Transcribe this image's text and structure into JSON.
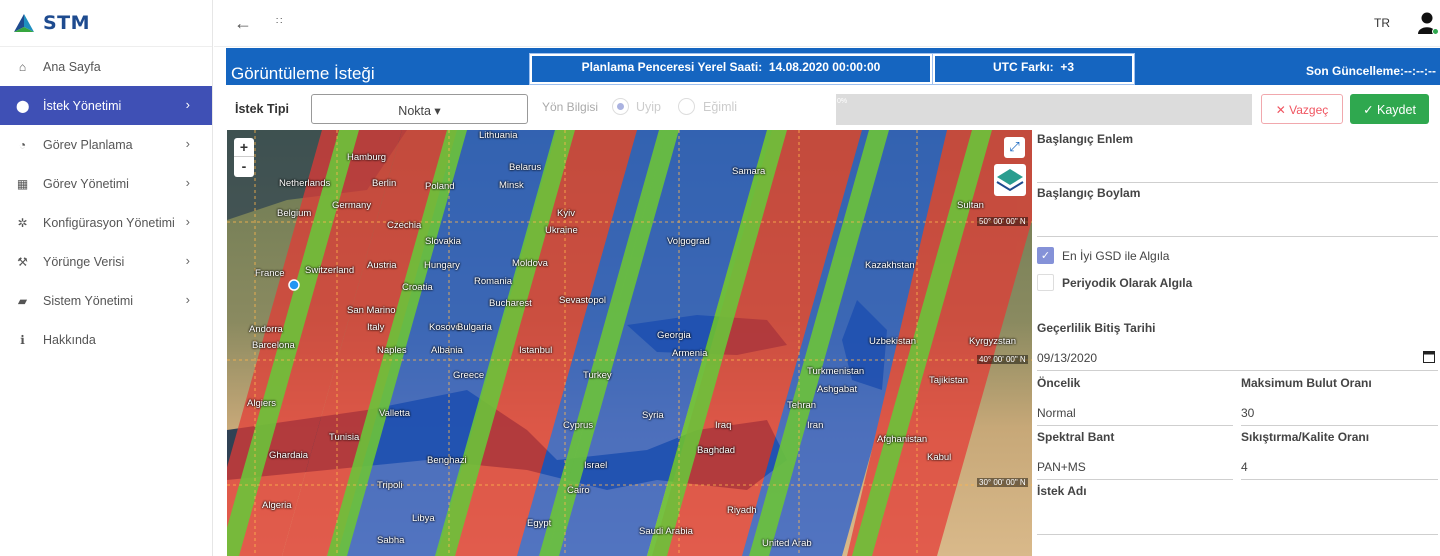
{
  "brand": {
    "name": "STM"
  },
  "sidebar": {
    "items": [
      {
        "label": "Ana Sayfa",
        "icon": "home-icon",
        "chev": ""
      },
      {
        "label": "İstek Yönetimi",
        "icon": "map-pin-icon",
        "chev": "›",
        "active": true
      },
      {
        "label": "Görev Planlama",
        "icon": "clock-icon",
        "chev": "›"
      },
      {
        "label": "Görev Yönetimi",
        "icon": "grid-icon",
        "chev": "›"
      },
      {
        "label": "Konfigürasyon Yönetimi",
        "icon": "gear-icon",
        "chev": "›"
      },
      {
        "label": "Yörünge Verisi",
        "icon": "wrench-icon",
        "chev": "›"
      },
      {
        "label": "Sistem Yönetimi",
        "icon": "briefcase-icon",
        "chev": "›"
      },
      {
        "label": "Hakkında",
        "icon": "info-icon",
        "chev": ""
      }
    ]
  },
  "topbar": {
    "back": "←",
    "drag": "∷",
    "language": "TR"
  },
  "header": {
    "title": "Görüntüleme İsteği",
    "window_label": "Planlama Penceresi Yerel Saati:",
    "window_value": "14.08.2020 00:00:00",
    "utc_label": "UTC Farkı:",
    "utc_value": "+3",
    "last_update": "Son Güncelleme:--:--:--"
  },
  "controls": {
    "request_type_label": "İstek Tipi",
    "request_type_value": "Nokta ▾",
    "direction_label": "Yön Bilgisi",
    "radio_options": [
      "Uyip",
      "Eğimli"
    ],
    "progress_text": "0%",
    "progress": 0,
    "cancel_label": "✕ Vazgeç",
    "save_label": "✓ Kaydet"
  },
  "map": {
    "zoom_in": "+",
    "zoom_out": "-",
    "fullscreen": "⤢",
    "grid_labels": [
      "50° 00' 00\" N",
      "40° 00' 00\" N",
      "30° 00' 00\" N"
    ],
    "cities": [
      {
        "name": "Lithuania"
      },
      {
        "name": "Netherlands"
      },
      {
        "name": "Germany"
      },
      {
        "name": "Poland"
      },
      {
        "name": "Belarus"
      },
      {
        "name": "Belgium"
      },
      {
        "name": "Czechia"
      },
      {
        "name": "Slovakia"
      },
      {
        "name": "Ukraine"
      },
      {
        "name": "Volgograd"
      },
      {
        "name": "Samara"
      },
      {
        "name": "Sultan"
      },
      {
        "name": "Berlin"
      },
      {
        "name": "Hamburg"
      },
      {
        "name": "Minsk"
      },
      {
        "name": "Kyiv"
      },
      {
        "name": "France"
      },
      {
        "name": "Switzerland"
      },
      {
        "name": "Austria"
      },
      {
        "name": "Hungary"
      },
      {
        "name": "Moldova"
      },
      {
        "name": "Kazakhstan"
      },
      {
        "name": "Croatia"
      },
      {
        "name": "Romania"
      },
      {
        "name": "San Marino"
      },
      {
        "name": "Bucharest"
      },
      {
        "name": "Sevastopol"
      },
      {
        "name": "Andorra"
      },
      {
        "name": "Italy"
      },
      {
        "name": "Kosovo"
      },
      {
        "name": "Bulgaria"
      },
      {
        "name": "Barcelona"
      },
      {
        "name": "Georgia"
      },
      {
        "name": "Armenia"
      },
      {
        "name": "Naples"
      },
      {
        "name": "Albania"
      },
      {
        "name": "Istanbul"
      },
      {
        "name": "Uzbekistan"
      },
      {
        "name": "Kyrgyzstan"
      },
      {
        "name": "Greece"
      },
      {
        "name": "Turkey"
      },
      {
        "name": "Turkmenistan"
      },
      {
        "name": "Tajikistan"
      },
      {
        "name": "Ashgabat"
      },
      {
        "name": "Algiers"
      },
      {
        "name": "Valletta"
      },
      {
        "name": "Tunisia"
      },
      {
        "name": "Cyprus"
      },
      {
        "name": "Syria"
      },
      {
        "name": "Iraq"
      },
      {
        "name": "Iran"
      },
      {
        "name": "Afghanistan"
      },
      {
        "name": "Ghardaia"
      },
      {
        "name": "Benghazi"
      },
      {
        "name": "Israel"
      },
      {
        "name": "Baghdad"
      },
      {
        "name": "Kabul"
      },
      {
        "name": "Algeria"
      },
      {
        "name": "Libya"
      },
      {
        "name": "Egypt"
      },
      {
        "name": "Saudi Arabia"
      },
      {
        "name": "United Arab"
      },
      {
        "name": "Tripoli"
      },
      {
        "name": "Sabha"
      },
      {
        "name": "Cairo"
      },
      {
        "name": "Riyadh"
      },
      {
        "name": "Tehran"
      }
    ]
  },
  "form": {
    "start_lat_label": "Başlangıç Enlem",
    "start_lat_value": "",
    "start_lon_label": "Başlangıç Boylam",
    "start_lon_value": "",
    "best_gsd_label": "En İyi GSD ile Algıla",
    "best_gsd_checked": true,
    "periodic_label": "Periyodik Olarak Algıla",
    "periodic_checked": false,
    "validity_label": "Geçerlilik Bitiş Tarihi",
    "validity_value": "09/13/2020",
    "priority_label": "Öncelik",
    "priority_value": "Normal",
    "max_cloud_label": "Maksimum Bulut Oranı",
    "max_cloud_value": "30",
    "spectral_label": "Spektral Bant",
    "spectral_value": "PAN+MS",
    "compression_label": "Sıkıştırma/Kalite Oranı",
    "compression_value": "4",
    "request_name_label": "İstek Adı",
    "request_name_value": ""
  }
}
